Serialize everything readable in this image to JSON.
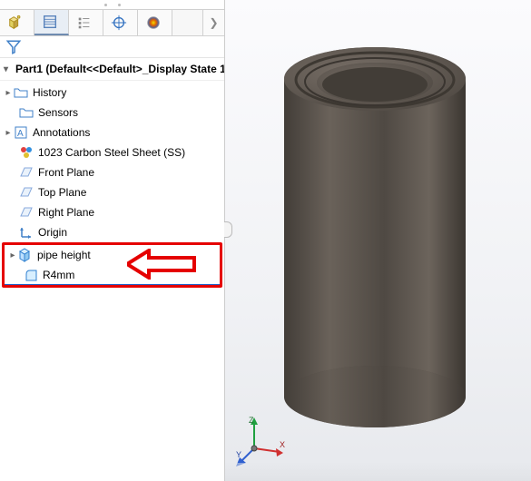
{
  "tabs": {
    "chevron": "❯"
  },
  "header": {
    "title": "Part1  (Default<<Default>_Display State 1"
  },
  "tree": {
    "history": "History",
    "sensors": "Sensors",
    "annotations": "Annotations",
    "material": "1023 Carbon Steel Sheet (SS)",
    "front_plane": "Front Plane",
    "top_plane": "Top Plane",
    "right_plane": "Right Plane",
    "origin": "Origin",
    "pipe_height": "pipe height",
    "r4mm": "R4mm"
  },
  "triad": {
    "x": "X",
    "y": "Y",
    "z": "Z"
  },
  "colors": {
    "highlight": "#e50000",
    "part_color": "#5d5650"
  }
}
